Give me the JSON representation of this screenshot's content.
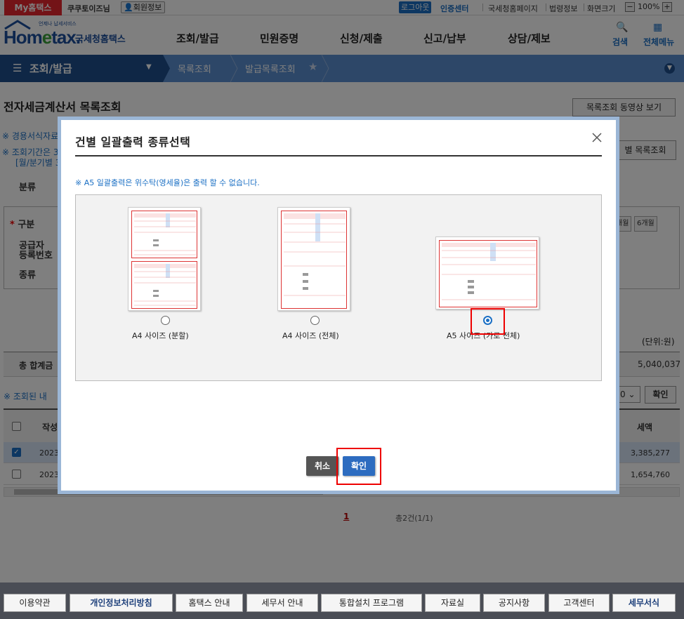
{
  "topbar": {
    "myhome": "My홈택스",
    "user": "쿠쿠토이즈님",
    "member": "회원정보",
    "logout": "로그아웃",
    "cert": "인증센터",
    "links": [
      "국세청홈페이지",
      "법령정보",
      "화면크기"
    ],
    "zoom": "100%"
  },
  "header": {
    "logo_main": "Hom",
    "logo_e": "e",
    "logo_tail": "tax.",
    "logo_kr": "국세청홈택스",
    "logo_small": "언제나 납세서비스",
    "menu": [
      "조회/발급",
      "민원증명",
      "신청/제출",
      "신고/납부",
      "상담/제보"
    ],
    "search": "검색",
    "all_menu": "전체메뉴"
  },
  "nav": {
    "home": "조회/발급",
    "crumbs": [
      "목록조회",
      "발급목록조회"
    ]
  },
  "page": {
    "title": "전자세금계산서 목록조회",
    "video_btn": "목록조회 동영상 보기",
    "note1": "※ 경용서식자료",
    "note2": "※ 조회기간은 3",
    "note3": "[월/분기별 3",
    "sub_btn": "별 목록조회",
    "filter_label": "분류",
    "form_labels": [
      "구분",
      "공급자",
      "등록번호",
      "종류"
    ],
    "small_btns": [
      "개월",
      "6개월"
    ],
    "unit": "(단위:원)",
    "sum_label": "총 합계금",
    "sum_value": "5,040,037",
    "list_note": "※ 조회된 내",
    "page_size": "0",
    "confirm": "확인",
    "col_date": "작성",
    "col_tax": "세액",
    "rows": [
      {
        "date": "2023-",
        "tax": "3,385,277",
        "checked": true
      },
      {
        "date": "2023-",
        "tax": "1,654,760",
        "checked": false
      }
    ],
    "pager_current": "1",
    "pager_total": "총2건(1/1)"
  },
  "modal": {
    "title": "건별 일괄출력 종류선택",
    "note": "※ A5 일괄출력은 위수탁(영세율)은 출력 할 수 없습니다.",
    "options": [
      {
        "label": "A4 사이즈 (분할)",
        "selected": false
      },
      {
        "label": "A4 사이즈 (전체)",
        "selected": false
      },
      {
        "label": "A5 사이즈 (가로 전체)",
        "selected": true
      }
    ],
    "cancel": "취소",
    "ok": "확인"
  },
  "footer": {
    "items": [
      "이용약관",
      "개인정보처리방침",
      "홈택스 안내",
      "세무서 안내",
      "통합설치 프로그램",
      "자료실",
      "공지사항",
      "고객센터",
      "세무서식"
    ]
  },
  "colors": {
    "brand_red": "#e6262e",
    "brand_blue": "#1d4f9c",
    "nav_blue": "#5b8fd0",
    "highlight": "#ee0000"
  }
}
